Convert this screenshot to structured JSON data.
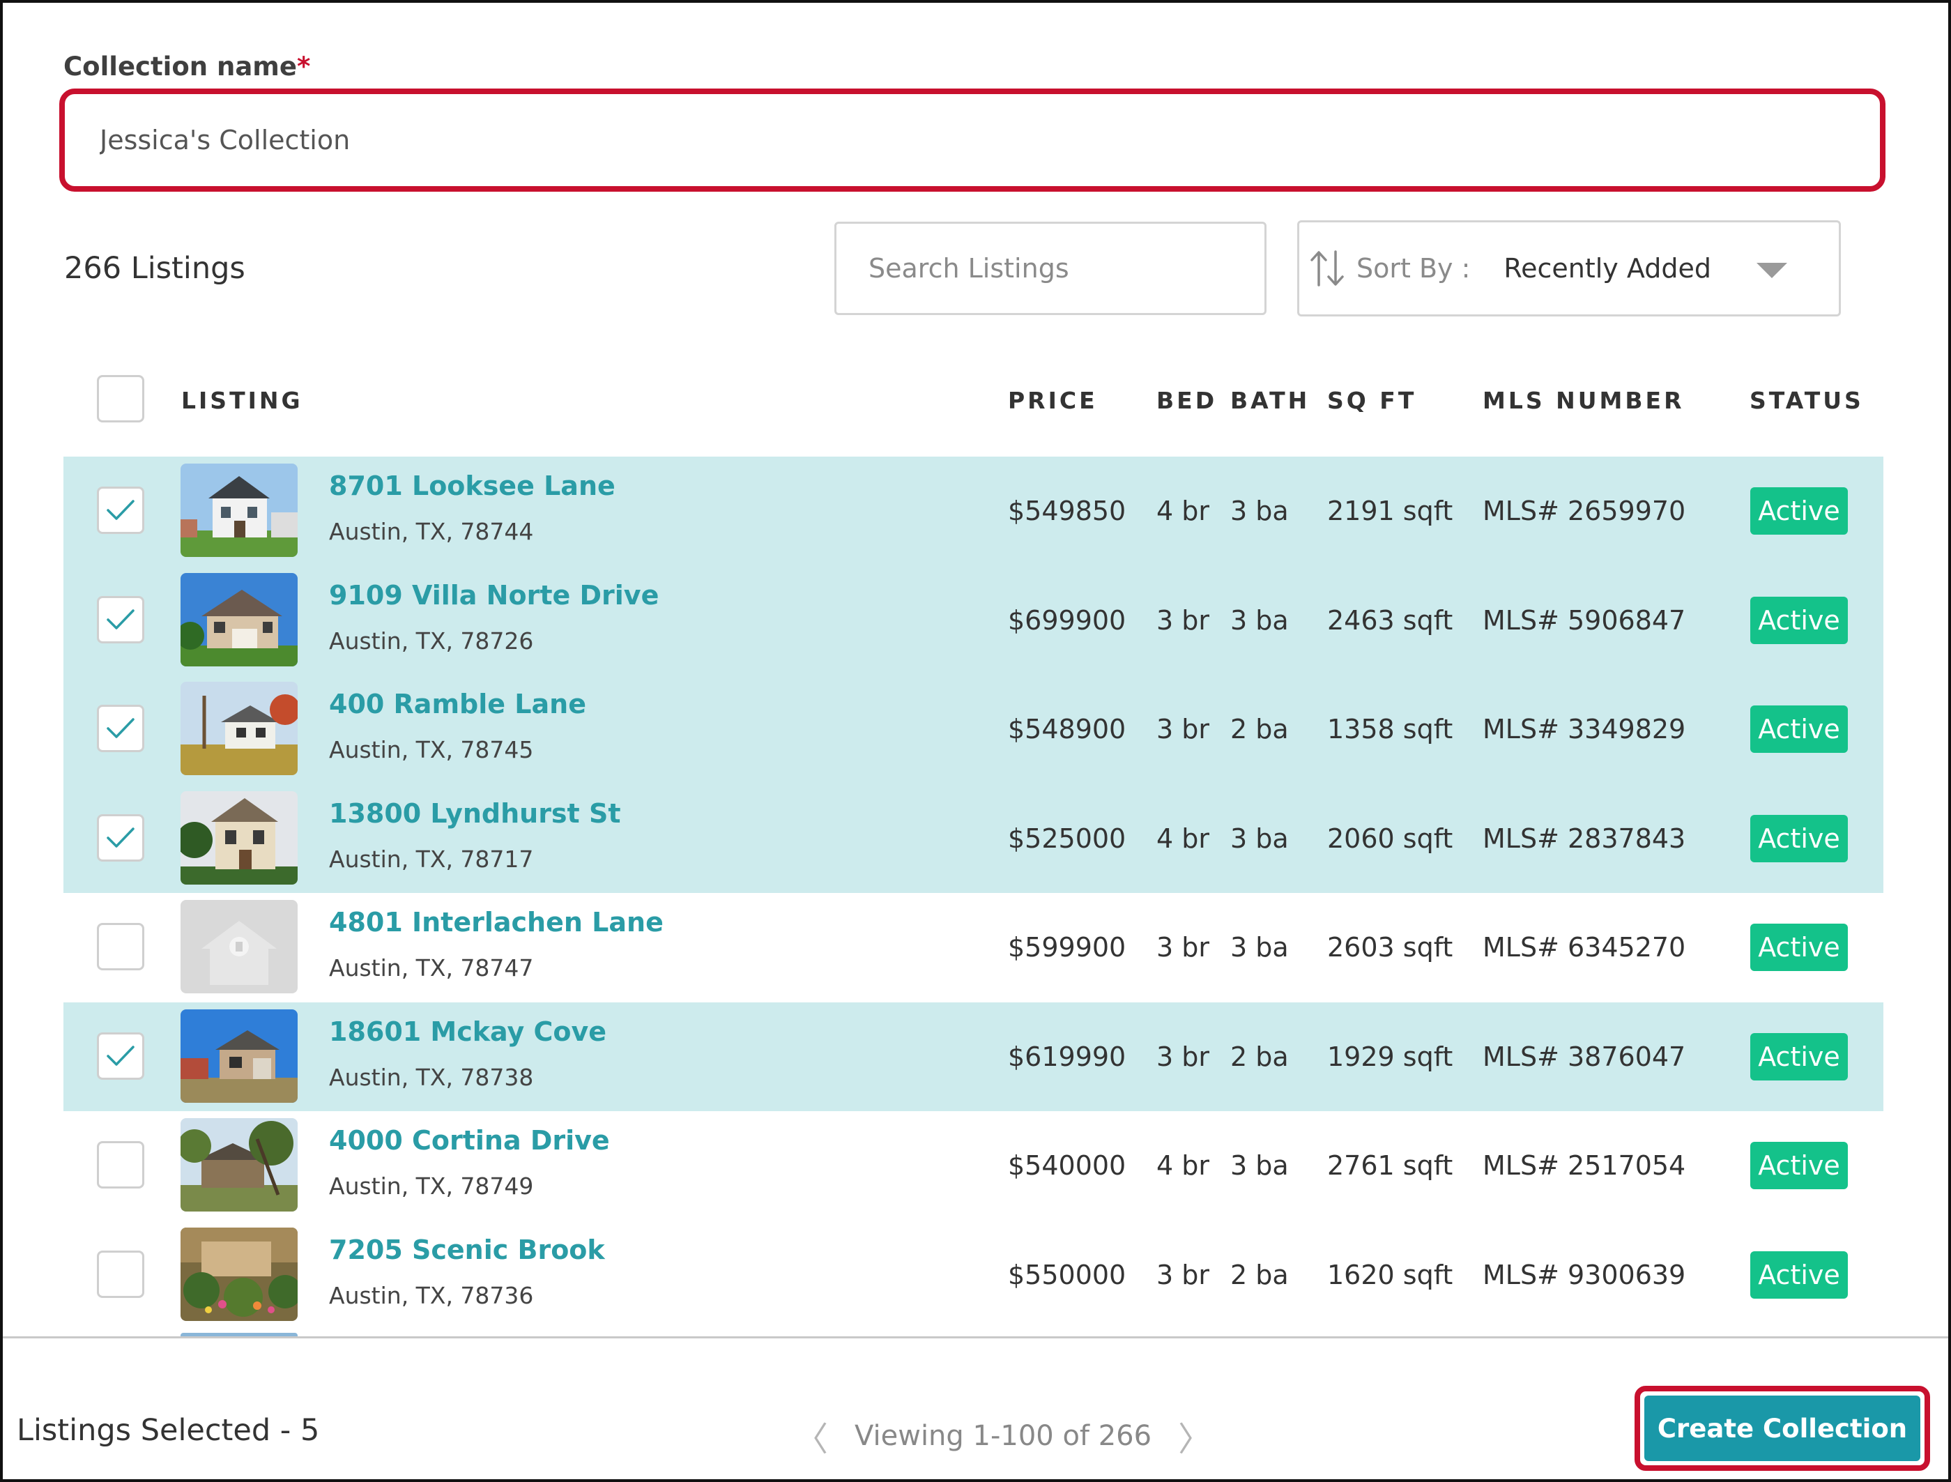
{
  "form": {
    "collection_label": "Collection name",
    "required_mark": "*",
    "collection_value": "Jessica's Collection"
  },
  "toolbar": {
    "listing_count": "266 Listings",
    "search_placeholder": "Search Listings",
    "sort_label": "Sort By :",
    "sort_value": "Recently Added"
  },
  "table": {
    "headers": {
      "listing": "LISTING",
      "price": "PRICE",
      "bed": "BED",
      "bath": "BATH",
      "sqft": "SQ FT",
      "mls": "MLS NUMBER",
      "status": "STATUS"
    },
    "rows": [
      {
        "address": "8701 Looksee Lane",
        "city": "Austin, TX, 78744",
        "price": "$549850",
        "bed": "4 br",
        "bath": "3 ba",
        "sqft": "2191 sqft",
        "mls": "MLS# 2659970",
        "status": "Active",
        "selected": true,
        "thumb": "house-white"
      },
      {
        "address": "9109 Villa Norte Drive",
        "city": "Austin, TX, 78726",
        "price": "$699900",
        "bed": "3 br",
        "bath": "3 ba",
        "sqft": "2463 sqft",
        "mls": "MLS# 5906847",
        "status": "Active",
        "selected": true,
        "thumb": "house-stone"
      },
      {
        "address": "400 Ramble Lane",
        "city": "Austin, TX, 78745",
        "price": "$548900",
        "bed": "3 br",
        "bath": "2 ba",
        "sqft": "1358 sqft",
        "mls": "MLS# 3349829",
        "status": "Active",
        "selected": true,
        "thumb": "house-yard"
      },
      {
        "address": "13800 Lyndhurst St",
        "city": "Austin, TX, 78717",
        "price": "$525000",
        "bed": "4 br",
        "bath": "3 ba",
        "sqft": "2060 sqft",
        "mls": "MLS# 2837843",
        "status": "Active",
        "selected": true,
        "thumb": "house-beige"
      },
      {
        "address": "4801 Interlachen Lane",
        "city": "Austin, TX, 78747",
        "price": "$599900",
        "bed": "3 br",
        "bath": "3 ba",
        "sqft": "2603 sqft",
        "mls": "MLS# 6345270",
        "status": "Active",
        "selected": false,
        "thumb": "placeholder"
      },
      {
        "address": "18601 Mckay Cove",
        "city": "Austin, TX, 78738",
        "price": "$619990",
        "bed": "3 br",
        "bath": "2 ba",
        "sqft": "1929 sqft",
        "mls": "MLS# 3876047",
        "status": "Active",
        "selected": true,
        "thumb": "house-sky"
      },
      {
        "address": "4000 Cortina Drive",
        "city": "Austin, TX, 78749",
        "price": "$540000",
        "bed": "4 br",
        "bath": "3 ba",
        "sqft": "2761 sqft",
        "mls": "MLS# 2517054",
        "status": "Active",
        "selected": false,
        "thumb": "house-trees"
      },
      {
        "address": "7205 Scenic Brook",
        "city": "Austin, TX, 78736",
        "price": "$550000",
        "bed": "3 br",
        "bath": "2 ba",
        "sqft": "1620 sqft",
        "mls": "MLS# 9300639",
        "status": "Active",
        "selected": false,
        "thumb": "house-garden"
      }
    ]
  },
  "footer": {
    "selected_text": "Listings Selected - 5",
    "pager_text": "Viewing 1-100 of 266",
    "create_button": "Create Collection"
  },
  "colors": {
    "accent": "#1a98a8",
    "link": "#2a9ca6",
    "selected_row": "#cdebed",
    "status_active": "#14c28a",
    "highlight": "#c8102e"
  }
}
